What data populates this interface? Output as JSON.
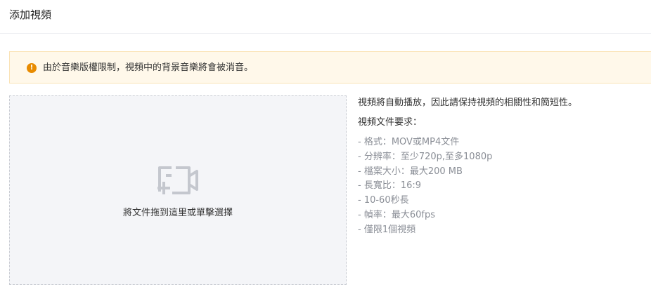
{
  "header": {
    "title": "添加視頻"
  },
  "notice": {
    "icon": "info-icon",
    "icon_color": "#e88b00",
    "icon_glyph": "!",
    "text": "由於音樂版權限制，視頻中的背景音樂將會被消音。"
  },
  "dropzone": {
    "icon": "add-video-icon",
    "label": "將文件拖到這里或單擊選擇"
  },
  "info": {
    "description": "視頻將自動播放，因此請保持視頻的相關性和簡短性。",
    "requirements_title": "視頻文件要求：",
    "requirements": [
      "- 格式：MOV或MP4文件",
      "- 分辨率：至少720p,至多1080p",
      "- 檔案大小：最大200 MB",
      "- 長寬比：16:9",
      "- 10-60秒長",
      "- 幀率：最大60fps",
      "- 僅限1個視頻"
    ]
  }
}
